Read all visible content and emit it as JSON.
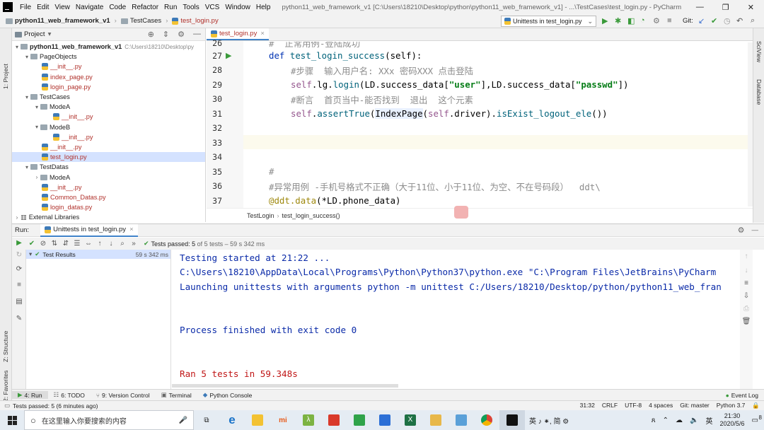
{
  "menubar": {
    "items": [
      "File",
      "Edit",
      "View",
      "Navigate",
      "Code",
      "Refactor",
      "Run",
      "Tools",
      "VCS",
      "Window",
      "Help"
    ],
    "window_title": "python11_web_framework_v1 [C:\\Users\\18210\\Desktop\\python\\python11_web_framework_v1] - ...\\TestCases\\test_login.py - PyCharm"
  },
  "navbar": {
    "project": "python11_web_framework_v1",
    "folder": "TestCases",
    "file": "test_login.py",
    "run_config": "Unittests in test_login.py",
    "git_label": "Git:"
  },
  "sidestrip": {
    "project": "1: Project",
    "structure": "Z: Structure",
    "favorites": "2: Favorites",
    "sciview": "SciView",
    "database": "Database"
  },
  "project_panel": {
    "title": "Project",
    "tree": [
      {
        "label": "python11_web_framework_v1",
        "extra": "C:\\Users\\18210\\Desktop\\py",
        "type": "root"
      },
      {
        "label": "PageObjects",
        "type": "folder"
      },
      {
        "label": "__init__.py",
        "type": "file"
      },
      {
        "label": "index_page.py",
        "type": "file"
      },
      {
        "label": "login_page.py",
        "type": "file"
      },
      {
        "label": "TestCases",
        "type": "folder"
      },
      {
        "label": "ModeA",
        "type": "folder"
      },
      {
        "label": "__init__.py",
        "type": "file"
      },
      {
        "label": "ModeB",
        "type": "folder"
      },
      {
        "label": "__init__.py",
        "type": "file"
      },
      {
        "label": "__init__.py",
        "type": "file"
      },
      {
        "label": "test_login.py",
        "type": "file"
      },
      {
        "label": "TestDatas",
        "type": "folder"
      },
      {
        "label": "ModeA",
        "type": "folder"
      },
      {
        "label": "__init__.py",
        "type": "file"
      },
      {
        "label": "Common_Datas.py",
        "type": "file"
      },
      {
        "label": "login_datas.py",
        "type": "file"
      },
      {
        "label": "External Libraries",
        "type": "lib"
      }
    ]
  },
  "editor": {
    "tab": "test_login.py",
    "lines": [
      "26",
      "27",
      "28",
      "29",
      "30",
      "31",
      "32",
      "33",
      "34",
      "35",
      "36",
      "37"
    ],
    "code": {
      "l26": "#  正常用例-登陆成功",
      "l27_def": "def",
      "l27_name": "test_login_success",
      "l27_rest": "(self):",
      "l28": "#步骤  输入用户名: XXx 密码XXX 点击登陆",
      "l29_a": "self",
      "l29_b": ".lg.",
      "l29_c": "login",
      "l29_d": "(LD.success_data[",
      "l29_e": "\"user\"",
      "l29_f": "],LD.success_data[",
      "l29_g": "\"passwd\"",
      "l29_h": "])",
      "l30": "#断言  首页当中-能否找到  退出  这个元素",
      "l31_a": "self",
      "l31_b": ".",
      "l31_c": "assertTrue",
      "l31_d": "(",
      "l31_e": "IndexPage",
      "l31_f": "(",
      "l31_g": "self",
      "l31_h": ".driver).",
      "l31_i": "isExist_logout_ele",
      "l31_j": "())",
      "l35": "#",
      "l36": "#异常用例 -手机号格式不正确（大于11位、小于11位、为空、不在号码段）  ddt\\",
      "l37_a": "@ddt.data",
      "l37_b": "(*LD.phone_data)"
    },
    "breadcrumb": [
      "TestLogin",
      "test_login_success()"
    ]
  },
  "run_panel": {
    "label": "Run:",
    "tab": "Unittests in test_login.py",
    "status": "Tests passed:",
    "status_count": "5",
    "status_rest": "of 5 tests – 59 s 342 ms",
    "results_label": "Test Results",
    "results_time": "59 s 342 ms",
    "console": [
      "Testing started at 21:22 ...",
      "C:\\Users\\18210\\AppData\\Local\\Programs\\Python\\Python37\\python.exe \"C:\\Program Files\\JetBrains\\PyCharm",
      "Launching unittests with arguments python -m unittest C:/Users/18210/Desktop/python/python11_web_fran",
      "",
      "",
      "Process finished with exit code 0",
      "",
      "",
      "Ran 5 tests in 59.348s"
    ]
  },
  "bottom_tabs": [
    "4: Run",
    "6: TODO",
    "9: Version Control",
    "Terminal",
    "Python Console",
    "Event Log"
  ],
  "statusbar": {
    "left": "Tests passed: 5 (6 minutes ago)",
    "items": [
      "31:32",
      "CRLF",
      "UTF-8",
      "4 spaces",
      "Git: master",
      "Python 3.7"
    ]
  },
  "taskbar": {
    "search_placeholder": "在这里输入你要搜索的内容",
    "ime": "英 ♪ ⁕, 简 ⚙",
    "lang": "英",
    "time": "21:30",
    "date": "2020/5/6",
    "notif_count": "8"
  },
  "colors": {
    "accent": "#4083c9",
    "keyword": "#0033b3",
    "string": "#067d17",
    "comment": "#8c8c8c",
    "console": "#0a2aa8",
    "pass": "#4a9c3a"
  }
}
